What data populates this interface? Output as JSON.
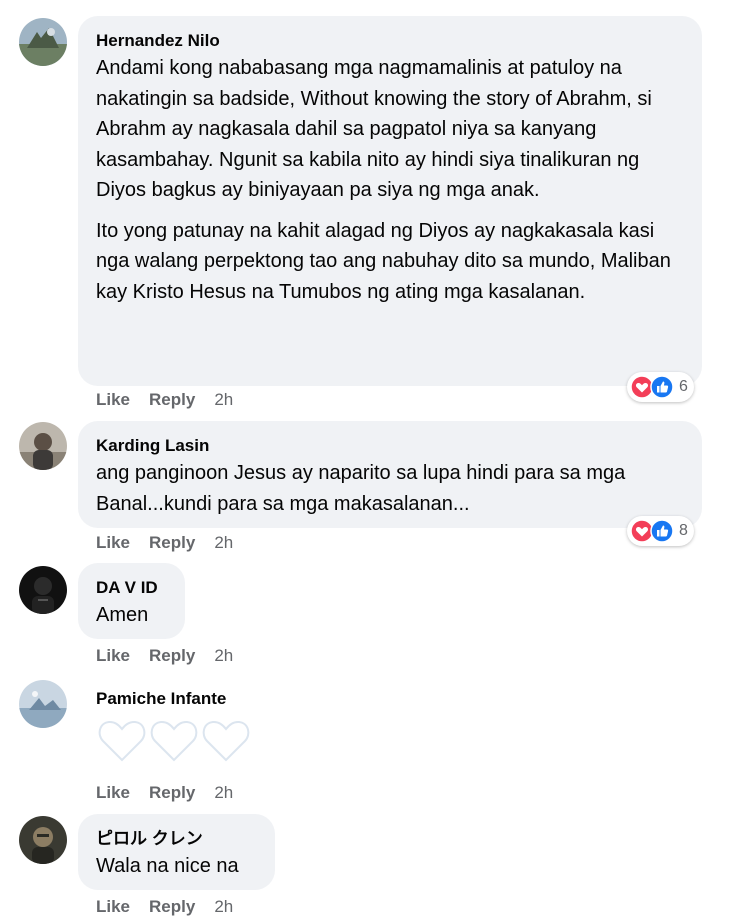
{
  "colors": {
    "bubble": "#f0f2f5",
    "meta_text": "#65676b",
    "love": "#f33e58",
    "like": "#1877f2"
  },
  "comments": [
    {
      "author": "Hernandez Nilo",
      "paragraphs": [
        "Andami kong nababasang mga nagmamalinis at patuloy na nakatingin sa badside, Without knowing the story of Abrahm, si Abrahm ay nagkasala dahil sa pagpatol niya sa kanyang kasambahay. Ngunit sa kabila nito ay hindi siya tinalikuran ng Diyos bagkus ay biniyayaan pa siya ng mga anak.",
        "Ito yong patunay na kahit alagad ng Diyos ay nagkakasala kasi nga walang perpektong tao ang nabuhay dito sa mundo, Maliban kay Kristo Hesus na Tumubos ng ating mga kasalanan."
      ],
      "like_label": "Like",
      "reply_label": "Reply",
      "time": "2h",
      "reaction_icons": [
        "love-icon",
        "like-icon"
      ],
      "reaction_count": "6"
    },
    {
      "author": "Karding Lasin",
      "paragraphs": [
        "ang panginoon Jesus ay naparito sa lupa hindi para sa mga Banal...kundi para sa mga makasalanan..."
      ],
      "like_label": "Like",
      "reply_label": "Reply",
      "time": "2h",
      "reaction_icons": [
        "love-icon",
        "like-icon"
      ],
      "reaction_count": "8"
    },
    {
      "author": "DA V ID",
      "paragraphs": [
        "Amen"
      ],
      "like_label": "Like",
      "reply_label": "Reply",
      "time": "2h"
    },
    {
      "author": "Pamiche Infante",
      "content_icons": [
        "white-heart-icon",
        "white-heart-icon",
        "white-heart-icon"
      ],
      "like_label": "Like",
      "reply_label": "Reply",
      "time": "2h"
    },
    {
      "author": "ピロル クレン",
      "paragraphs": [
        "Wala na nice na"
      ],
      "like_label": "Like",
      "reply_label": "Reply",
      "time": "2h"
    }
  ]
}
